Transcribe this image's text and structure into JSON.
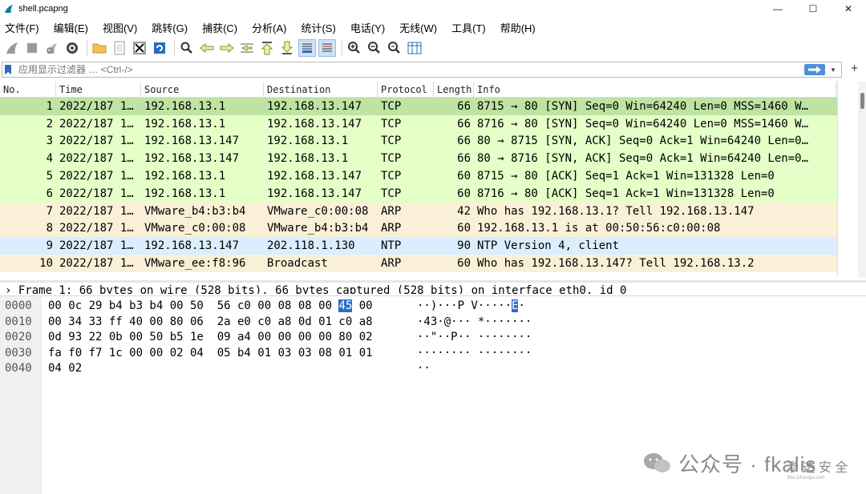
{
  "window": {
    "title": "shell.pcapng",
    "minimize": "—",
    "maximize": "☐",
    "close": "✕"
  },
  "menu": [
    "文件(F)",
    "编辑(E)",
    "视图(V)",
    "跳转(G)",
    "捕获(C)",
    "分析(A)",
    "统计(S)",
    "电话(Y)",
    "无线(W)",
    "工具(T)",
    "帮助(H)"
  ],
  "toolbar": {
    "icons": [
      "shark-fin-start-icon",
      "stop-square-icon",
      "restart-fin-icon",
      "capture-options-gear-icon",
      "open-folder-icon",
      "save-file-icon",
      "close-file-icon",
      "reload-icon",
      "find-magnifier-icon",
      "go-back-arrow-icon",
      "go-forward-arrow-icon",
      "go-to-packet-icon",
      "go-first-icon",
      "go-last-icon",
      "autoscroll-icon",
      "colorize-icon",
      "zoom-in-icon",
      "zoom-out-icon",
      "zoom-normal-icon",
      "resize-columns-icon"
    ]
  },
  "filter": {
    "placeholder": "应用显示过滤器 … <Ctrl-/>"
  },
  "columns": {
    "no": "No.",
    "time": "Time",
    "source": "Source",
    "destination": "Destination",
    "protocol": "Protocol",
    "length": "Length",
    "info": "Info"
  },
  "packets": [
    {
      "no": "1",
      "time": "2022/187 1…",
      "src": "192.168.13.1",
      "dst": "192.168.13.147",
      "proto": "TCP",
      "len": "66",
      "info": "8715 → 80 [SYN] Seq=0 Win=64240 Len=0 MSS=1460 W…",
      "kind": "tcp",
      "selected": true
    },
    {
      "no": "2",
      "time": "2022/187 1…",
      "src": "192.168.13.1",
      "dst": "192.168.13.147",
      "proto": "TCP",
      "len": "66",
      "info": "8716 → 80 [SYN] Seq=0 Win=64240 Len=0 MSS=1460 W…",
      "kind": "tcp"
    },
    {
      "no": "3",
      "time": "2022/187 1…",
      "src": "192.168.13.147",
      "dst": "192.168.13.1",
      "proto": "TCP",
      "len": "66",
      "info": "80 → 8715 [SYN, ACK] Seq=0 Ack=1 Win=64240 Len=0…",
      "kind": "tcp"
    },
    {
      "no": "4",
      "time": "2022/187 1…",
      "src": "192.168.13.147",
      "dst": "192.168.13.1",
      "proto": "TCP",
      "len": "66",
      "info": "80 → 8716 [SYN, ACK] Seq=0 Ack=1 Win=64240 Len=0…",
      "kind": "tcp"
    },
    {
      "no": "5",
      "time": "2022/187 1…",
      "src": "192.168.13.1",
      "dst": "192.168.13.147",
      "proto": "TCP",
      "len": "60",
      "info": "8715 → 80 [ACK] Seq=1 Ack=1 Win=131328 Len=0",
      "kind": "tcp"
    },
    {
      "no": "6",
      "time": "2022/187 1…",
      "src": "192.168.13.1",
      "dst": "192.168.13.147",
      "proto": "TCP",
      "len": "60",
      "info": "8716 → 80 [ACK] Seq=1 Ack=1 Win=131328 Len=0",
      "kind": "tcp"
    },
    {
      "no": "7",
      "time": "2022/187 1…",
      "src": "VMware_b4:b3:b4",
      "dst": "VMware_c0:00:08",
      "proto": "ARP",
      "len": "42",
      "info": "Who has 192.168.13.1? Tell 192.168.13.147",
      "kind": "arp"
    },
    {
      "no": "8",
      "time": "2022/187 1…",
      "src": "VMware_c0:00:08",
      "dst": "VMware_b4:b3:b4",
      "proto": "ARP",
      "len": "60",
      "info": "192.168.13.1 is at 00:50:56:c0:00:08",
      "kind": "arp"
    },
    {
      "no": "9",
      "time": "2022/187 1…",
      "src": "192.168.13.147",
      "dst": "202.118.1.130",
      "proto": "NTP",
      "len": "90",
      "info": "NTP Version 4, client",
      "kind": "ntp"
    },
    {
      "no": "10",
      "time": "2022/187 1…",
      "src": "VMware_ee:f8:96",
      "dst": "Broadcast",
      "proto": "ARP",
      "len": "60",
      "info": "Who has 192.168.13.147? Tell 192.168.13.2",
      "kind": "arp"
    }
  ],
  "details": {
    "line": "› Frame 1: 66 bytes on wire (528 bits), 66 bytes captured (528 bits) on interface eth0, id 0"
  },
  "bytes": [
    {
      "offset": "0000",
      "hex_a": "00 0c 29 b4 b3 b4 00 50  56 c0 00 08 08 00 ",
      "hex_hl": "45",
      "hex_b": " 00",
      "ascii_a": "··)···P V·····",
      "ascii_hl": "E",
      "ascii_b": "·"
    },
    {
      "offset": "0010",
      "hex_a": "00 34 33 ff 40 00 80 06  2a e0 c0 a8 0d 01 c0 a8",
      "hex_hl": "",
      "hex_b": "",
      "ascii_a": "·43·@··· *·······",
      "ascii_hl": "",
      "ascii_b": ""
    },
    {
      "offset": "0020",
      "hex_a": "0d 93 22 0b 00 50 b5 1e  09 a4 00 00 00 00 80 02",
      "hex_hl": "",
      "hex_b": "",
      "ascii_a": "··\"··P·· ········",
      "ascii_hl": "",
      "ascii_b": ""
    },
    {
      "offset": "0030",
      "hex_a": "fa f0 f7 1c 00 00 02 04  05 b4 01 03 03 08 01 01",
      "hex_hl": "",
      "hex_b": "",
      "ascii_a": "········ ········",
      "ascii_hl": "",
      "ascii_b": ""
    },
    {
      "offset": "0040",
      "hex_a": "04 02",
      "hex_hl": "",
      "hex_b": "",
      "ascii_a": "··",
      "ascii_hl": "",
      "ascii_b": ""
    }
  ],
  "watermark": {
    "text": "公众号 · fkalis",
    "seal": "渗 透 安 全",
    "site": "bbs.ichunqiu.com"
  }
}
